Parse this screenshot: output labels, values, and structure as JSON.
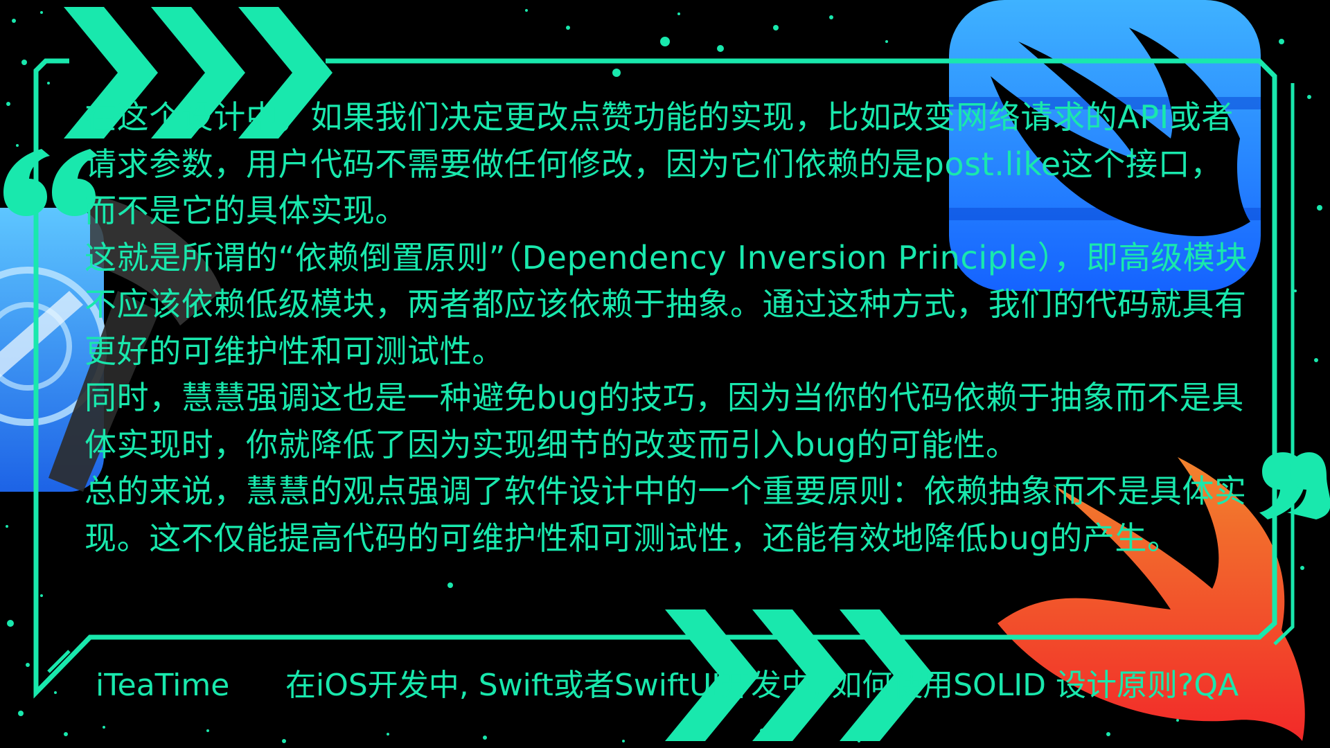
{
  "colors": {
    "accent": "#19e8ad",
    "background": "#000000",
    "swift_blue": "#1f8fff",
    "swift_red": "#ff4a2a",
    "xcode_blue": "#2a8cff"
  },
  "icons": {
    "open_quote": "open-quote-icon",
    "close_quote": "close-quote-icon",
    "arrows_top": "chevron-arrows-icon",
    "arrows_bottom": "chevron-arrows-icon",
    "swiftui_logo": "swiftui-logo-icon",
    "swift_logo": "swift-logo-icon",
    "xcode_logo": "xcode-logo-icon"
  },
  "content": {
    "paragraphs": [
      "在这个设计中，如果我们决定更改点赞功能的实现，比如改变网络请求的API或者请求参数，用户代码不需要做任何修改，因为它们依赖的是post.like这个接口，而不是它的具体实现。",
      "这就是所谓的“依赖倒置原则”（Dependency Inversion Principle），即高级模块不应该依赖低级模块，两者都应该依赖于抽象。通过这种方式，我们的代码就具有更好的可维护性和可测试性。",
      "同时，慧慧强调这也是一种避免bug的技巧，因为当你的代码依赖于抽象而不是具体实现时，你就降低了因为实现细节的改变而引入bug的可能性。",
      "总的来说，慧慧的观点强调了软件设计中的一个重要原则：依赖抽象而不是具体实现。这不仅能提高代码的可维护性和可测试性，还能有效地降低bug的产生。"
    ]
  },
  "footer": {
    "brand": "iTeaTime",
    "title": "在iOS开发中, Swift或者SwiftUI开发中, 如何使用SOLID 设计原则?QA"
  }
}
